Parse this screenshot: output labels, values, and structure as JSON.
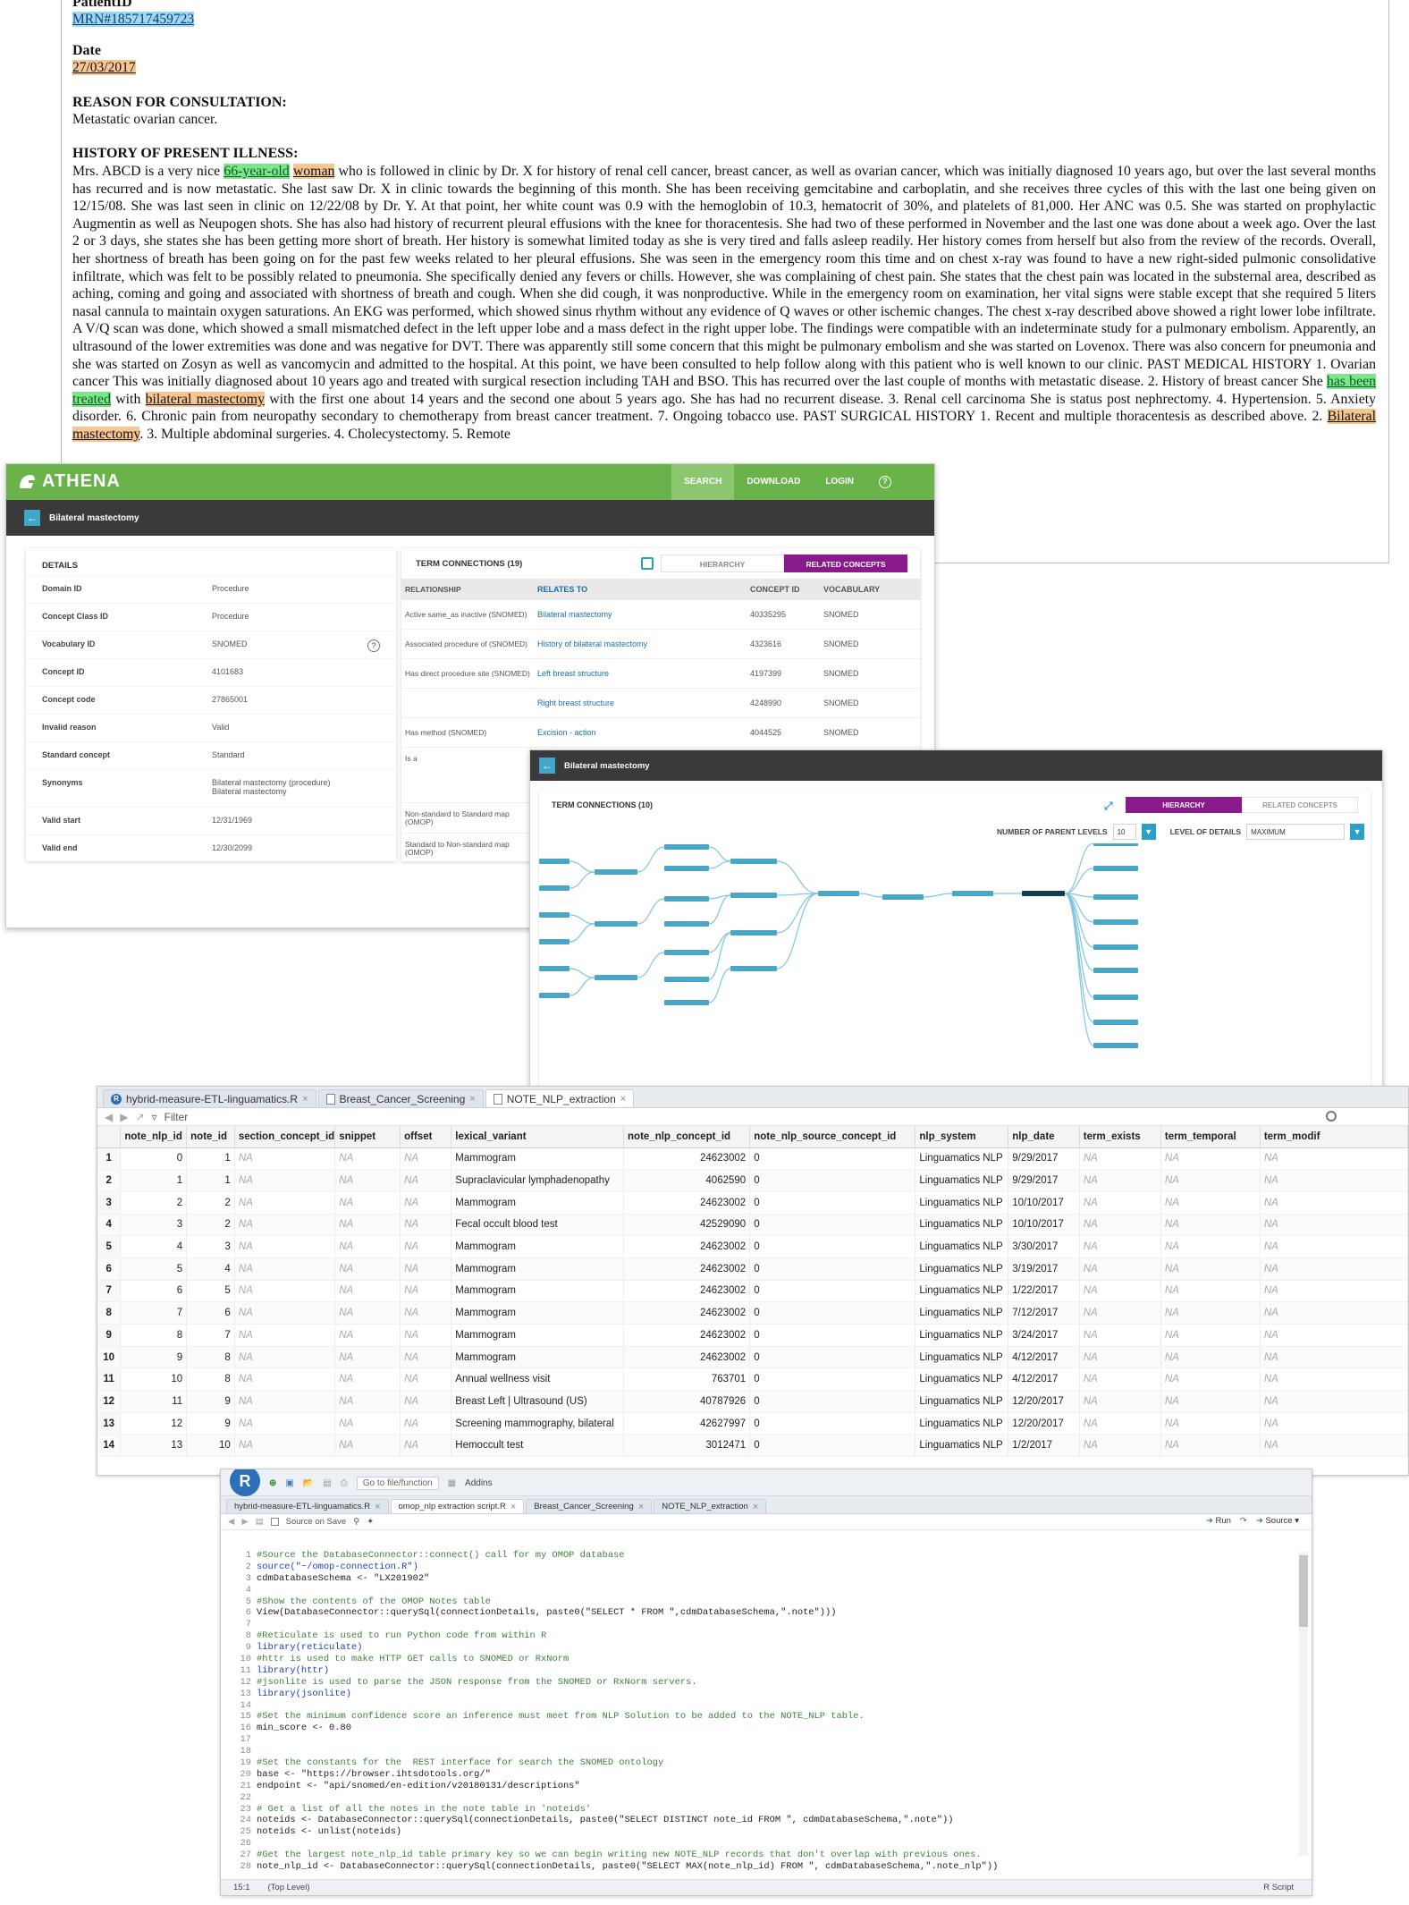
{
  "note": {
    "patient_id_label": "PatientID",
    "patient_id_value": "MRN#185717459723",
    "date_label": "Date",
    "date_value": "27/03/2017",
    "reason_heading": "REASON FOR CONSULTATION:",
    "reason_text": "Metastatic ovarian cancer.",
    "hpi_heading": "HISTORY OF PRESENT ILLNESS:",
    "hpi_a": "Mrs. ABCD is a very nice ",
    "hpi_age": "66-year-old",
    "hpi_woman": "woman",
    "hpi_b": " who is followed in clinic by Dr. X for history of renal cell cancer, breast cancer, as well as ovarian cancer, which was initially diagnosed 10 years ago, but over the last several months has recurred and is now metastatic. She last saw Dr. X in clinic towards the beginning of this month. She has been receiving gemcitabine and carboplatin, and she receives three cycles of this with the last one being given on 12/15/08. She was last seen in clinic on 12/22/08 by Dr. Y. At that point, her white count was 0.9 with the hemoglobin of 10.3, hematocrit of 30%, and platelets of 81,000. Her ANC was 0.5. She was started on prophylactic Augmentin as well as Neupogen shots. She has also had history of recurrent pleural effusions with the knee for thoracentesis. She had two of these performed in November and the last one was done about a week ago. Over the last 2 or 3 days, she states she has been getting more short of breath. Her history is somewhat limited today as she is very tired and falls asleep readily. Her history comes from herself but also from the review of the records. Overall, her shortness of breath has been going on for the past few weeks related to her pleural effusions. She was seen in the emergency room this time and on chest x-ray was found to have a new right-sided pulmonic consolidative infiltrate, which was felt to be possibly related to pneumonia. She specifically denied any fevers or chills. However, she was complaining of chest pain. She states that the chest pain was located in the substernal area, described as aching, coming and going and associated with shortness of breath and cough. When she did cough, it was nonproductive. While in the emergency room on examination, her vital signs were stable except that she required 5 liters nasal cannula to maintain oxygen saturations. An EKG was performed, which showed sinus rhythm without any evidence of Q waves or other ischemic changes. The chest x-ray described above showed a right lower lobe infiltrate. A V/Q scan was done, which showed a small mismatched defect in the left upper lobe and a mass defect in the right upper lobe. The findings were compatible with an indeterminate study for a pulmonary embolism. Apparently, an ultrasound of the lower extremities was done and was negative for DVT. There was apparently still some concern that this might be pulmonary embolism and she was started on Lovenox. There was also concern for pneumonia and she was started on Zosyn as well as vancomycin and admitted to the hospital. At this point, we have been consulted to help follow along with this patient who is well known to our clinic. PAST MEDICAL HISTORY 1. Ovarian cancer This was initially diagnosed about 10 years ago and treated with surgical resection including TAH and BSO. This has recurred over the last couple of months with metastatic disease. 2. History of breast cancer She ",
    "hpi_treated": "has been treated",
    "hpi_c": " with ",
    "hpi_bilat": "bilateral mastectomy",
    "hpi_d": " with the first one about 14 years and the second one about 5 years ago. She has had no recurrent disease. 3. Renal cell carcinoma She is status post nephrectomy. 4. Hypertension. 5. Anxiety disorder. 6. Chronic pain from neuropathy secondary to chemotherapy from breast cancer treatment. 7. Ongoing tobacco use. PAST SURGICAL HISTORY 1. Recent and multiple thoracentesis as described above. 2. ",
    "hpi_bilat2": "Bilateral mastectomy",
    "hpi_e": ". 3. Multiple abdominal surgeries. 4. Cholecystectomy. 5. Remote"
  },
  "athena1": {
    "logo": "ATHENA",
    "nav": [
      "SEARCH",
      "DOWNLOAD",
      "LOGIN"
    ],
    "help_icon": "?",
    "concept_title": "Bilateral mastectomy",
    "details_heading": "DETAILS",
    "details": [
      {
        "k": "Domain ID",
        "v": "Procedure"
      },
      {
        "k": "Concept Class ID",
        "v": "Procedure"
      },
      {
        "k": "Vocabulary ID",
        "v": "SNOMED"
      },
      {
        "k": "Concept ID",
        "v": "4101683"
      },
      {
        "k": "Concept code",
        "v": "27865001"
      },
      {
        "k": "Invalid reason",
        "v": "Valid"
      },
      {
        "k": "Standard concept",
        "v": "Standard"
      },
      {
        "k": "Synonyms",
        "v": "Bilateral mastectomy (procedure)\nBilateral mastectomy"
      },
      {
        "k": "Valid start",
        "v": "12/31/1969"
      },
      {
        "k": "Valid end",
        "v": "12/30/2099"
      }
    ],
    "terms_heading": "TERM CONNECTIONS (19)",
    "tab_hierarchy": "HIERARCHY",
    "tab_related": "RELATED CONCEPTS",
    "columns": [
      "RELATIONSHIP",
      "RELATES TO",
      "CONCEPT ID",
      "VOCABULARY"
    ],
    "rows": [
      {
        "rel": "Active same_as inactive (SNOMED)",
        "to": "Bilateral mastectomy",
        "id": "40335295",
        "voc": "SNOMED"
      },
      {
        "rel": "Associated procedure of (SNOMED)",
        "to": "History of bilateral mastectomy",
        "id": "4323616",
        "voc": "SNOMED"
      },
      {
        "rel": "Has direct procedure site (SNOMED)",
        "to": "Left breast structure",
        "id": "4197399",
        "voc": "SNOMED"
      },
      {
        "rel": "",
        "to": "Right breast structure",
        "id": "4248990",
        "voc": "SNOMED"
      },
      {
        "rel": "Has method (SNOMED)",
        "to": "Excision - action",
        "id": "4044525",
        "voc": "SNOMED"
      },
      {
        "rel": "Is a",
        "to": "",
        "id": "",
        "voc": ""
      },
      {
        "rel": "Non-standard to Standard map (OMOP)",
        "to": "",
        "id": "",
        "voc": ""
      },
      {
        "rel": "Standard to Non-standard map (OMOP)",
        "to": "",
        "id": "",
        "voc": ""
      }
    ]
  },
  "athena2": {
    "concept_title": "Bilateral mastectomy",
    "terms_heading": "TERM CONNECTIONS (10)",
    "tab_hierarchy": "HIERARCHY",
    "tab_related": "RELATED CONCEPTS",
    "parent_levels_label": "NUMBER OF PARENT LEVELS",
    "parent_levels_value": "10",
    "detail_label": "LEVEL OF DETAILS",
    "detail_value": "MAXIMUM",
    "center_node": "Bilateral mastectomy"
  },
  "viewer": {
    "tabs": [
      "hybrid-measure-ETL-linguamatics.R",
      "Breast_Cancer_Screening",
      "NOTE_NLP_extraction"
    ],
    "filter_label": "Filter",
    "columns": [
      "",
      "note_nlp_id",
      "note_id",
      "section_concept_id",
      "snippet",
      "offset",
      "lexical_variant",
      "note_nlp_concept_id",
      "note_nlp_source_concept_id",
      "nlp_system",
      "nlp_date",
      "term_exists",
      "term_temporal",
      "term_modif"
    ],
    "rows": [
      [
        "1",
        "0",
        "1",
        "NA",
        "NA",
        "NA",
        "Mammogram",
        "24623002",
        "0",
        "Linguamatics NLP",
        "9/29/2017",
        "NA",
        "NA",
        "NA"
      ],
      [
        "2",
        "1",
        "1",
        "NA",
        "NA",
        "NA",
        "Supraclavicular lymphadenopathy",
        "4062590",
        "0",
        "Linguamatics NLP",
        "9/29/2017",
        "NA",
        "NA",
        "NA"
      ],
      [
        "3",
        "2",
        "2",
        "NA",
        "NA",
        "NA",
        "Mammogram",
        "24623002",
        "0",
        "Linguamatics NLP",
        "10/10/2017",
        "NA",
        "NA",
        "NA"
      ],
      [
        "4",
        "3",
        "2",
        "NA",
        "NA",
        "NA",
        "Fecal occult blood test",
        "42529090",
        "0",
        "Linguamatics NLP",
        "10/10/2017",
        "NA",
        "NA",
        "NA"
      ],
      [
        "5",
        "4",
        "3",
        "NA",
        "NA",
        "NA",
        "Mammogram",
        "24623002",
        "0",
        "Linguamatics NLP",
        "3/30/2017",
        "NA",
        "NA",
        "NA"
      ],
      [
        "6",
        "5",
        "4",
        "NA",
        "NA",
        "NA",
        "Mammogram",
        "24623002",
        "0",
        "Linguamatics NLP",
        "3/19/2017",
        "NA",
        "NA",
        "NA"
      ],
      [
        "7",
        "6",
        "5",
        "NA",
        "NA",
        "NA",
        "Mammogram",
        "24623002",
        "0",
        "Linguamatics NLP",
        "1/22/2017",
        "NA",
        "NA",
        "NA"
      ],
      [
        "8",
        "7",
        "6",
        "NA",
        "NA",
        "NA",
        "Mammogram",
        "24623002",
        "0",
        "Linguamatics NLP",
        "7/12/2017",
        "NA",
        "NA",
        "NA"
      ],
      [
        "9",
        "8",
        "7",
        "NA",
        "NA",
        "NA",
        "Mammogram",
        "24623002",
        "0",
        "Linguamatics NLP",
        "3/24/2017",
        "NA",
        "NA",
        "NA"
      ],
      [
        "10",
        "9",
        "8",
        "NA",
        "NA",
        "NA",
        "Mammogram",
        "24623002",
        "0",
        "Linguamatics NLP",
        "4/12/2017",
        "NA",
        "NA",
        "NA"
      ],
      [
        "11",
        "10",
        "8",
        "NA",
        "NA",
        "NA",
        "Annual wellness visit",
        "763701",
        "0",
        "Linguamatics NLP",
        "4/12/2017",
        "NA",
        "NA",
        "NA"
      ],
      [
        "12",
        "11",
        "9",
        "NA",
        "NA",
        "NA",
        "Breast Left | Ultrasound (US)",
        "40787926",
        "0",
        "Linguamatics NLP",
        "12/20/2017",
        "NA",
        "NA",
        "NA"
      ],
      [
        "13",
        "12",
        "9",
        "NA",
        "NA",
        "NA",
        "Screening mammography, bilateral",
        "42627997",
        "0",
        "Linguamatics NLP",
        "12/20/2017",
        "NA",
        "NA",
        "NA"
      ],
      [
        "14",
        "13",
        "10",
        "NA",
        "NA",
        "NA",
        "Hemoccult test",
        "3012471",
        "0",
        "Linguamatics NLP",
        "1/2/2017",
        "NA",
        "NA",
        "NA"
      ]
    ]
  },
  "editor": {
    "goto_placeholder": "Go to file/function",
    "addins": "Addins",
    "tabs": [
      "hybrid-measure-ETL-linguamatics.R",
      "omop_nlp extraction script.R",
      "Breast_Cancer_Screening",
      "NOTE_NLP_extraction"
    ],
    "source_on_save": "Source on Save",
    "run_label": "Run",
    "source_label": "Source",
    "lines": [
      {
        "n": "1",
        "t": "#Source the DatabaseConnector::connect() call for my OMOP database",
        "k": "cm"
      },
      {
        "n": "2",
        "t": "source(\"~/omop-connection.R\")",
        "k": "fn"
      },
      {
        "n": "3",
        "t": "cdmDatabaseSchema <- \"LX201902\"",
        "k": "ct"
      },
      {
        "n": "4",
        "t": "",
        "k": "ct"
      },
      {
        "n": "5",
        "t": "#Show the contents of the OMOP Notes table",
        "k": "cm"
      },
      {
        "n": "6",
        "t": "View(DatabaseConnector::querySql(connectionDetails, paste0(\"SELECT * FROM \",cdmDatabaseSchema,\".note\")))",
        "k": "ct"
      },
      {
        "n": "7",
        "t": "",
        "k": "ct"
      },
      {
        "n": "8",
        "t": "#Reticulate is used to run Python code from within R",
        "k": "cm"
      },
      {
        "n": "9",
        "t": "library(reticulate)",
        "k": "fn"
      },
      {
        "n": "10",
        "t": "#httr is used to make HTTP GET calls to SNOMED or RxNorm",
        "k": "cm"
      },
      {
        "n": "11",
        "t": "library(httr)",
        "k": "fn"
      },
      {
        "n": "12",
        "t": "#jsonlite is used to parse the JSON response from the SNOMED or RxNorm servers.",
        "k": "cm"
      },
      {
        "n": "13",
        "t": "library(jsonlite)",
        "k": "fn"
      },
      {
        "n": "14",
        "t": "",
        "k": "ct"
      },
      {
        "n": "15",
        "t": "#Set the minimum confidence score an inference must meet from NLP Solution to be added to the NOTE_NLP table.",
        "k": "cm"
      },
      {
        "n": "16",
        "t": "min_score <- 0.80",
        "k": "ct"
      },
      {
        "n": "17",
        "t": "",
        "k": "ct"
      },
      {
        "n": "18",
        "t": "",
        "k": "ct"
      },
      {
        "n": "19",
        "t": "#Set the constants for the  REST interface for search the SNOMED ontology",
        "k": "cm"
      },
      {
        "n": "20",
        "t": "base <- \"https://browser.ihtsdotools.org/\"",
        "k": "ct"
      },
      {
        "n": "21",
        "t": "endpoint <- \"api/snomed/en-edition/v20180131/descriptions\"",
        "k": "ct"
      },
      {
        "n": "22",
        "t": "",
        "k": "ct"
      },
      {
        "n": "23",
        "t": "# Get a list of all the notes in the note table in 'noteids'",
        "k": "cm"
      },
      {
        "n": "24",
        "t": "noteids <- DatabaseConnector::querySql(connectionDetails, paste0(\"SELECT DISTINCT note_id FROM \", cdmDatabaseSchema,\".note\"))",
        "k": "ct"
      },
      {
        "n": "25",
        "t": "noteids <- unlist(noteids)",
        "k": "ct"
      },
      {
        "n": "26",
        "t": "",
        "k": "ct"
      },
      {
        "n": "27",
        "t": "#Get the largest note_nlp_id table primary key so we can begin writing new NOTE_NLP records that don't overlap with previous ones.",
        "k": "cm"
      },
      {
        "n": "28",
        "t": "note_nlp_id <- DatabaseConnector::querySql(connectionDetails, paste0(\"SELECT MAX(note_nlp_id) FROM \", cdmDatabaseSchema,\".note_nlp\"))",
        "k": "ct"
      },
      {
        "n": "29",
        "t": "",
        "k": "ct"
      }
    ],
    "status_pos": "15:1",
    "status_scope": "(Top Level)",
    "status_type": "R Script"
  }
}
